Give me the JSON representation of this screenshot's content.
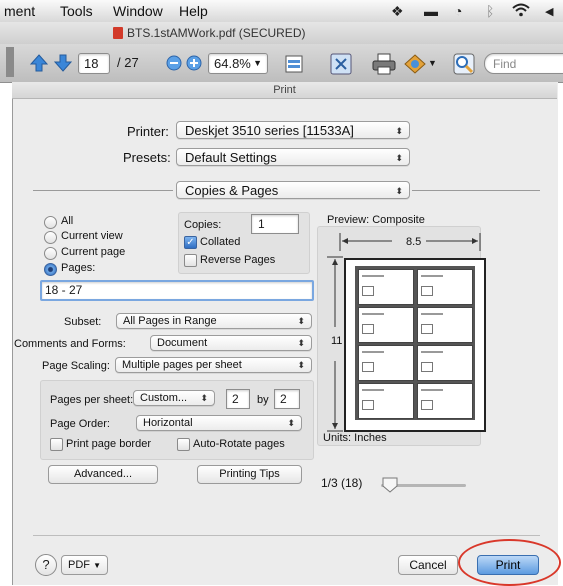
{
  "menubar": {
    "items": [
      "ment",
      "Tools",
      "Window",
      "Help"
    ],
    "tray_icons": [
      "dropbox-icon",
      "display-icon",
      "time-machine-icon",
      "bluetooth-icon",
      "wifi-icon",
      "volume-icon"
    ]
  },
  "window": {
    "title": "BTS.1stAMWork.pdf (SECURED)"
  },
  "toolbar": {
    "page_current": "18",
    "page_total": "/ 27",
    "zoom": "64.8%",
    "find_placeholder": "Find"
  },
  "print": {
    "title": "Print",
    "printer_label": "Printer:",
    "printer_value": "Deskjet 3510 series [11533A]",
    "presets_label": "Presets:",
    "presets_value": "Default Settings",
    "section_value": "Copies & Pages",
    "range_options": [
      "All",
      "Current view",
      "Current page",
      "Pages:"
    ],
    "pages_value": "18 - 27",
    "copies_label": "Copies:",
    "copies_value": "1",
    "collated_label": "Collated",
    "reverse_label": "Reverse Pages",
    "subset_label": "Subset:",
    "subset_value": "All Pages in Range",
    "comments_label": "Comments and Forms:",
    "comments_value": "Document",
    "scaling_label": "Page Scaling:",
    "scaling_value": "Multiple pages per sheet",
    "pps_label": "Pages per sheet:",
    "pps_value": "Custom...",
    "pps_cols": "2",
    "by_label": "by",
    "pps_rows": "2",
    "order_label": "Page Order:",
    "order_value": "Horizontal",
    "border_label": "Print page border",
    "autorotate_label": "Auto-Rotate pages",
    "advanced_button": "Advanced...",
    "tips_button": "Printing Tips",
    "preview_label": "Preview: Composite",
    "preview_width": "8.5",
    "preview_height": "11",
    "units": "Units: Inches",
    "page_indicator": "1/3 (18)",
    "help_button": "?",
    "pdf_button": "PDF",
    "cancel_button": "Cancel",
    "print_button": "Print",
    "highlight_color": "#d9382a"
  }
}
